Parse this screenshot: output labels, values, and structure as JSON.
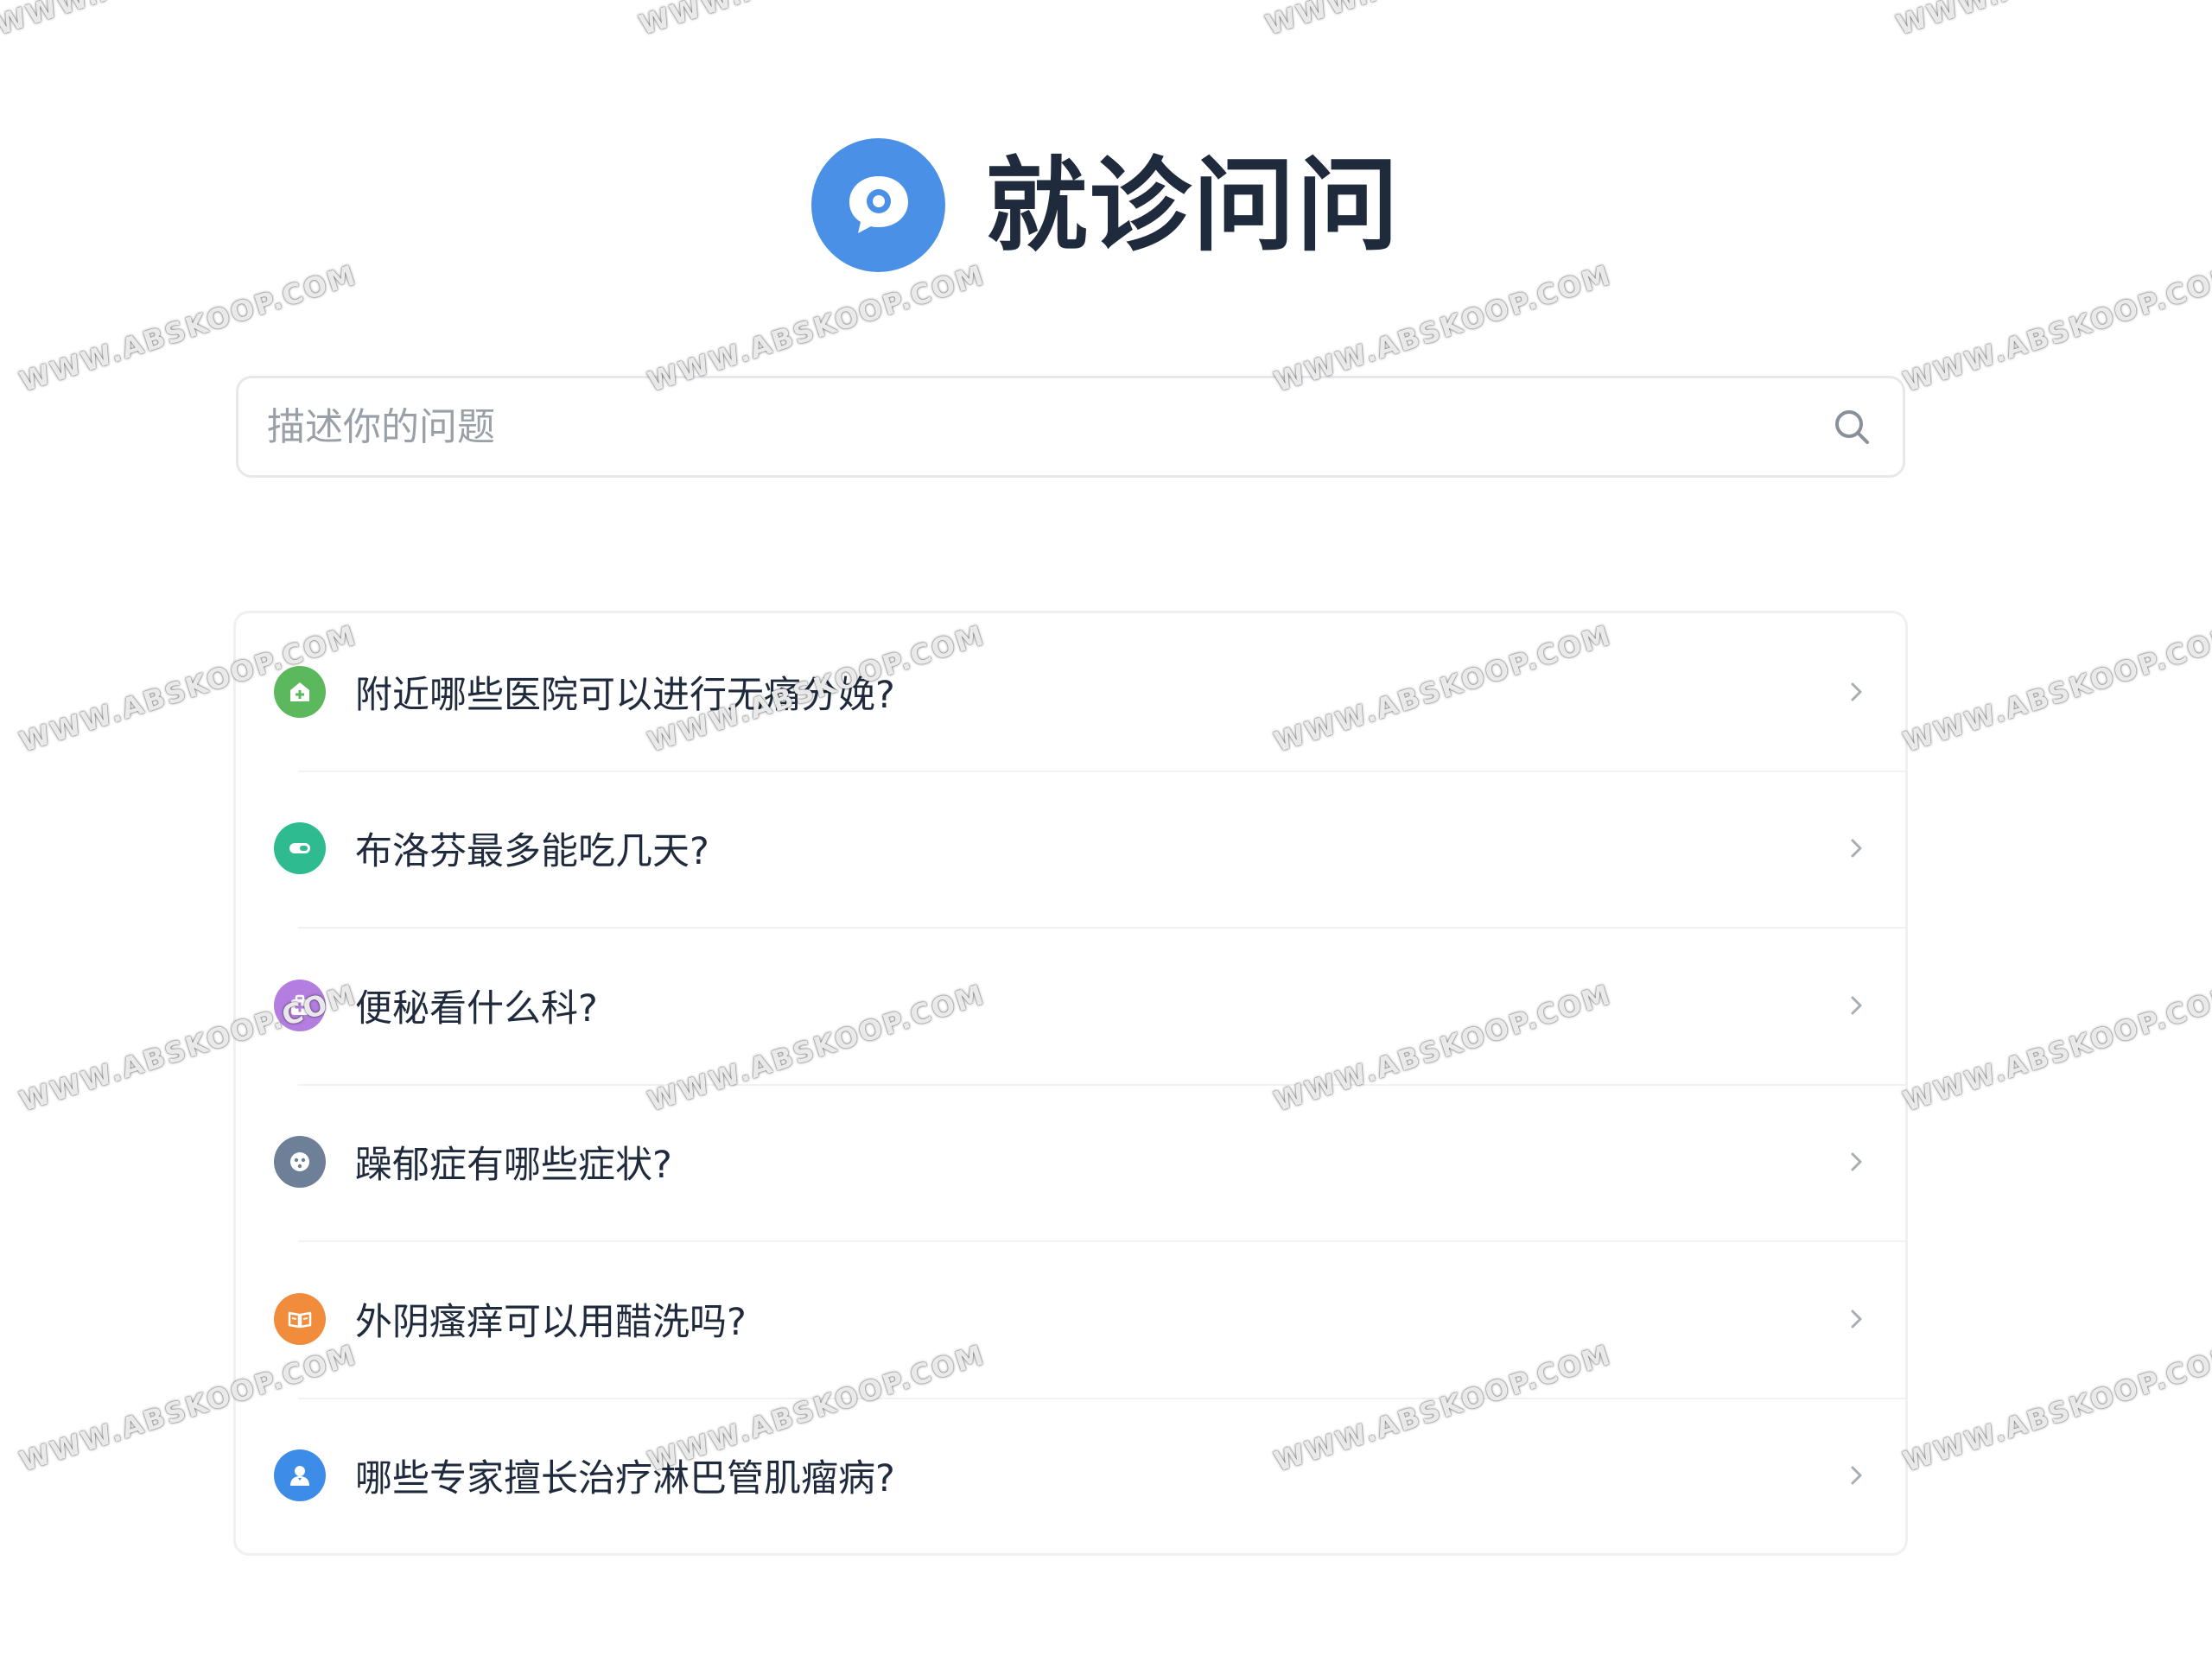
{
  "header": {
    "title": "就诊问问",
    "logo_icon": "chat-bubble-icon",
    "accent_color": "#4a90e6"
  },
  "search": {
    "placeholder": "描述你的问题",
    "value": "",
    "icon": "search-icon"
  },
  "questions": [
    {
      "label": "附近哪些医院可以进行无痛分娩?",
      "icon": "hospital-icon",
      "color": "#5cb85c"
    },
    {
      "label": "布洛芬最多能吃几天?",
      "icon": "pill-icon",
      "color": "#2dbb8f"
    },
    {
      "label": "便秘看什么科?",
      "icon": "medkit-icon",
      "color": "#b47ee0"
    },
    {
      "label": "躁郁症有哪些症状?",
      "icon": "face-icon",
      "color": "#6e7f98"
    },
    {
      "label": "外阴瘙痒可以用醋洗吗?",
      "icon": "book-icon",
      "color": "#f08c3c"
    },
    {
      "label": "哪些专家擅长治疗淋巴管肌瘤病?",
      "icon": "doctor-icon",
      "color": "#3d8ce8"
    }
  ],
  "watermark": {
    "text": "WWW.ABSKOOP.COM"
  }
}
